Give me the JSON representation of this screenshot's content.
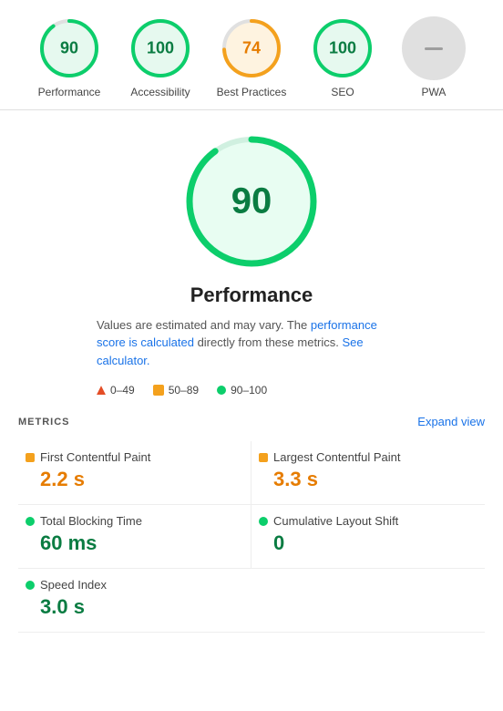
{
  "scores": [
    {
      "id": "performance",
      "label": "Performance",
      "value": 90,
      "color": "green",
      "strokeColor": "#0cce6b",
      "bgColor": "#e6f9ef"
    },
    {
      "id": "accessibility",
      "label": "Accessibility",
      "value": 100,
      "color": "green",
      "strokeColor": "#0cce6b",
      "bgColor": "#e6f9ef"
    },
    {
      "id": "best-practices",
      "label": "Best Practices",
      "value": 74,
      "color": "orange",
      "strokeColor": "#f4a11d",
      "bgColor": "#fef3e0"
    },
    {
      "id": "seo",
      "label": "SEO",
      "value": 100,
      "color": "green",
      "strokeColor": "#0cce6b",
      "bgColor": "#e6f9ef"
    },
    {
      "id": "pwa",
      "label": "PWA",
      "value": null,
      "color": "gray"
    }
  ],
  "detail": {
    "score": 90,
    "title": "Performance",
    "description_part1": "Values are estimated and may vary. The ",
    "description_link1_text": "performance score is calculated",
    "description_link1_href": "#",
    "description_part2": " directly from these metrics. ",
    "description_link2_text": "See calculator.",
    "description_link2_href": "#"
  },
  "legend": {
    "red_range": "0–49",
    "orange_range": "50–89",
    "green_range": "90–100"
  },
  "metrics_header": {
    "label": "METRICS",
    "expand_label": "Expand view"
  },
  "metrics": [
    {
      "id": "fcp",
      "name": "First Contentful Paint",
      "value": "2.2 s",
      "dot": "orange",
      "value_color": "orange"
    },
    {
      "id": "lcp",
      "name": "Largest Contentful Paint",
      "value": "3.3 s",
      "dot": "orange",
      "value_color": "orange"
    },
    {
      "id": "tbt",
      "name": "Total Blocking Time",
      "value": "60 ms",
      "dot": "green",
      "value_color": "green"
    },
    {
      "id": "cls",
      "name": "Cumulative Layout Shift",
      "value": "0",
      "dot": "green",
      "value_color": "green"
    },
    {
      "id": "si",
      "name": "Speed Index",
      "value": "3.0 s",
      "dot": "green",
      "value_color": "green"
    }
  ]
}
